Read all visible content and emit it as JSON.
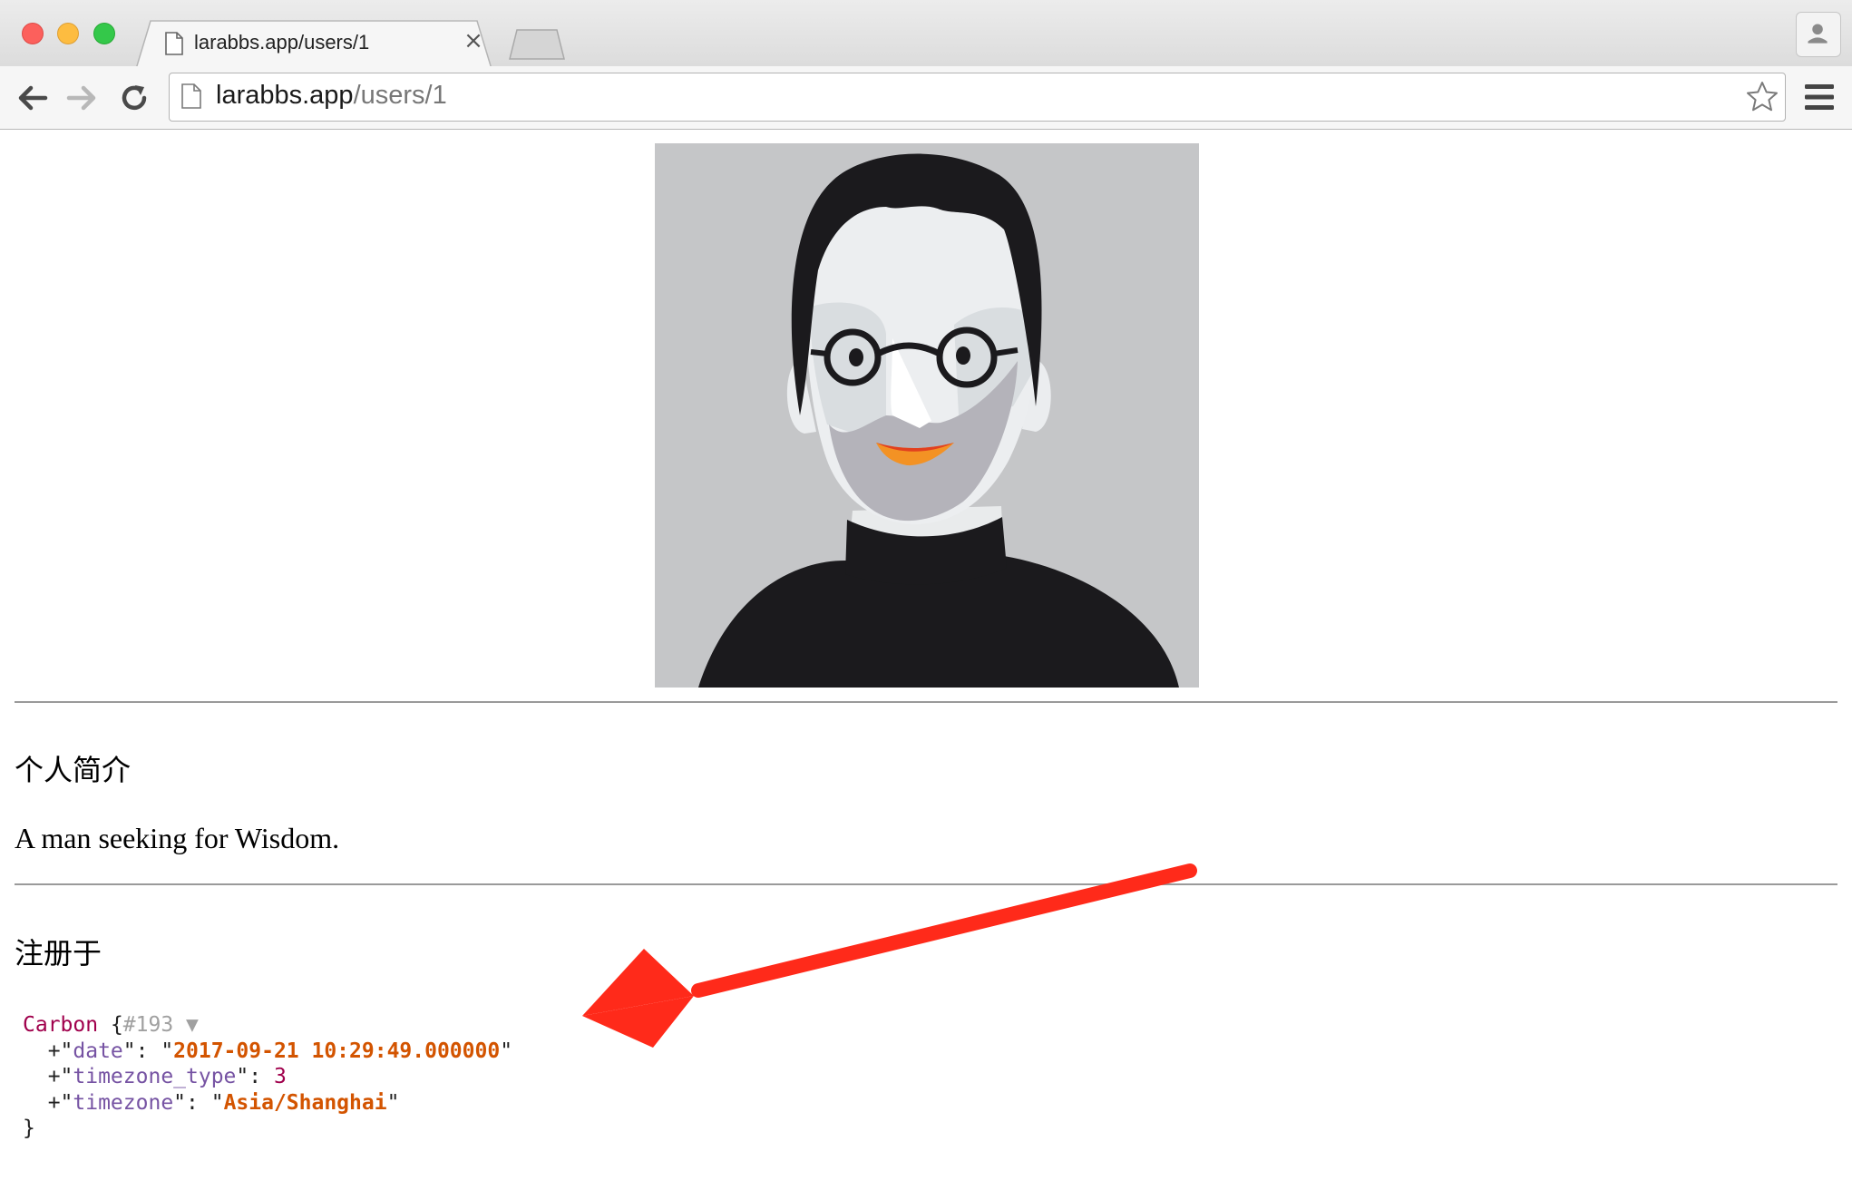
{
  "browser": {
    "tab_title": "larabbs.app/users/1",
    "tab_close": "×",
    "url_host": "larabbs.app",
    "url_path": "/users/1"
  },
  "profile": {
    "avatar_icon": "avatar-illustration",
    "intro_heading": "个人简介",
    "bio": "A man seeking for Wisdom.",
    "registered_heading": "注册于"
  },
  "dump": {
    "class_name": "Carbon",
    "open_brace": " {",
    "ref": "#193",
    "toggle": " ▼",
    "props": [
      {
        "prefix": "  +\"",
        "key": "date",
        "sep": "\": \"",
        "value": "2017-09-21 10:29:49.000000",
        "suffix": "\"",
        "type": "str"
      },
      {
        "prefix": "  +\"",
        "key": "timezone_type",
        "sep": "\": ",
        "value": "3",
        "suffix": "",
        "type": "num"
      },
      {
        "prefix": "  +\"",
        "key": "timezone",
        "sep": "\": \"",
        "value": "Asia/Shanghai",
        "suffix": "\"",
        "type": "str"
      }
    ],
    "close_brace": "}"
  },
  "colors": {
    "arrow": "#ff2a1a",
    "dump_class": "#a0004c",
    "dump_key": "#7653a3",
    "dump_string": "#d35400"
  }
}
